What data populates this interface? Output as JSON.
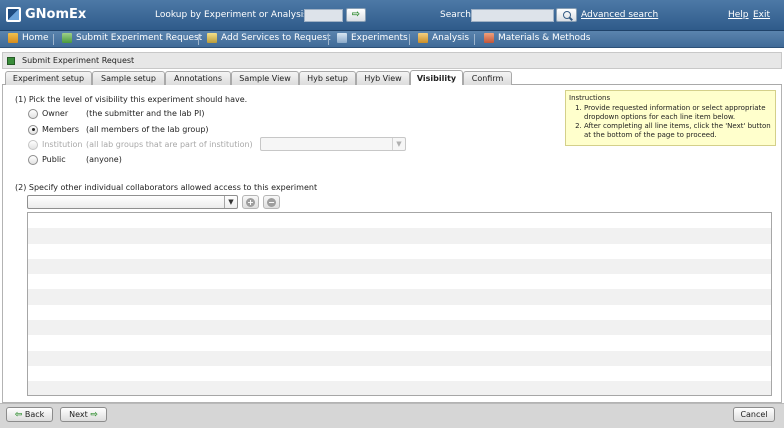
{
  "header": {
    "app_name": "GNomEx",
    "lookup_label": "Lookup by Experiment or Analysis #",
    "lookup_value": "",
    "go_icon": "arrow-right-icon",
    "search_label": "Search",
    "search_value": "",
    "advanced_search": "Advanced search",
    "help": "Help",
    "exit": "Exit"
  },
  "nav": {
    "items": [
      {
        "label": "Home",
        "icon": "home-icon"
      },
      {
        "label": "Submit Experiment Request",
        "icon": "submit-icon"
      },
      {
        "label": "Add Services to Request",
        "icon": "services-icon"
      },
      {
        "label": "Experiments",
        "icon": "flask-icon"
      },
      {
        "label": "Analysis",
        "icon": "chart-icon"
      },
      {
        "label": "Materials & Methods",
        "icon": "methods-icon"
      }
    ]
  },
  "panel": {
    "title": "Submit Experiment Request"
  },
  "tabs": [
    {
      "label": "Experiment setup"
    },
    {
      "label": "Sample setup"
    },
    {
      "label": "Annotations"
    },
    {
      "label": "Sample View"
    },
    {
      "label": "Hyb setup"
    },
    {
      "label": "Hyb View"
    },
    {
      "label": "Visibility",
      "active": true
    },
    {
      "label": "Confirm"
    }
  ],
  "visibility": {
    "question": "(1) Pick the level of visibility this experiment should have.",
    "options": [
      {
        "label": "Owner",
        "desc": "(the submitter and the lab PI)",
        "selected": false,
        "disabled": false
      },
      {
        "label": "Members",
        "desc": "(all members of the lab group)",
        "selected": true,
        "disabled": false
      },
      {
        "label": "Institution",
        "desc": "(all lab groups that are part of institution)",
        "selected": false,
        "disabled": true
      },
      {
        "label": "Public",
        "desc": "(anyone)",
        "selected": false,
        "disabled": false
      }
    ],
    "institution_value": ""
  },
  "instructions": {
    "title": "Instructions",
    "items": [
      "Provide requested information or select appropriate dropdown options for each line item below.",
      "After completing all line items, click the 'Next' button at the bottom of the page to proceed."
    ]
  },
  "collaborators": {
    "question": "(2) Specify other individual collaborators allowed access to this experiment",
    "selected_value": "",
    "add_icon": "add-icon",
    "remove_icon": "remove-icon"
  },
  "footer": {
    "back": "Back",
    "next": "Next",
    "cancel": "Cancel"
  },
  "colors": {
    "header": "#3a668f",
    "accent_green": "#2f8e2f",
    "instructions_bg": "#ffffcc"
  }
}
